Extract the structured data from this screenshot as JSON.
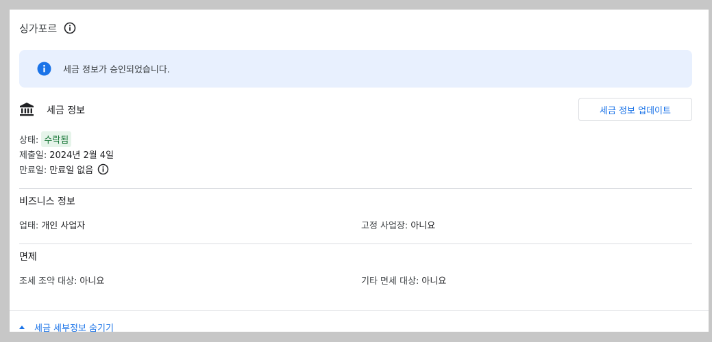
{
  "card": {
    "title": "싱가포르",
    "title_info_icon": "info-outline-icon"
  },
  "banner": {
    "icon": "info-filled-icon",
    "text": "세금 정보가 승인되었습니다.",
    "bg_color": "#e8f0fe",
    "icon_color": "#1a73e8"
  },
  "tax_info": {
    "icon": "bank-icon",
    "heading": "세금 정보",
    "update_button_label": "세금 정보 업데이트",
    "status_label": "상태:",
    "status_value": "수락됨",
    "status_color": "#137333",
    "submitted_label": "제출일:",
    "submitted_value": "2024년 2월 4일",
    "expiry_label": "만료일:",
    "expiry_value": "만료일 없음",
    "expiry_info_icon": "info-outline-icon"
  },
  "business_info": {
    "heading": "비즈니스 정보",
    "business_type_label": "업태:",
    "business_type_value": "개인 사업자",
    "fixed_place_label": "고정 사업장:",
    "fixed_place_value": "아니요"
  },
  "exemption": {
    "heading": "면제",
    "treaty_label": "조세 조약 대상:",
    "treaty_value": "아니요",
    "other_label": "기타 면세 대상:",
    "other_value": "아니요"
  },
  "footer": {
    "collapse_label": "세금 세부정보 숨기기",
    "link_color": "#1a73e8"
  }
}
